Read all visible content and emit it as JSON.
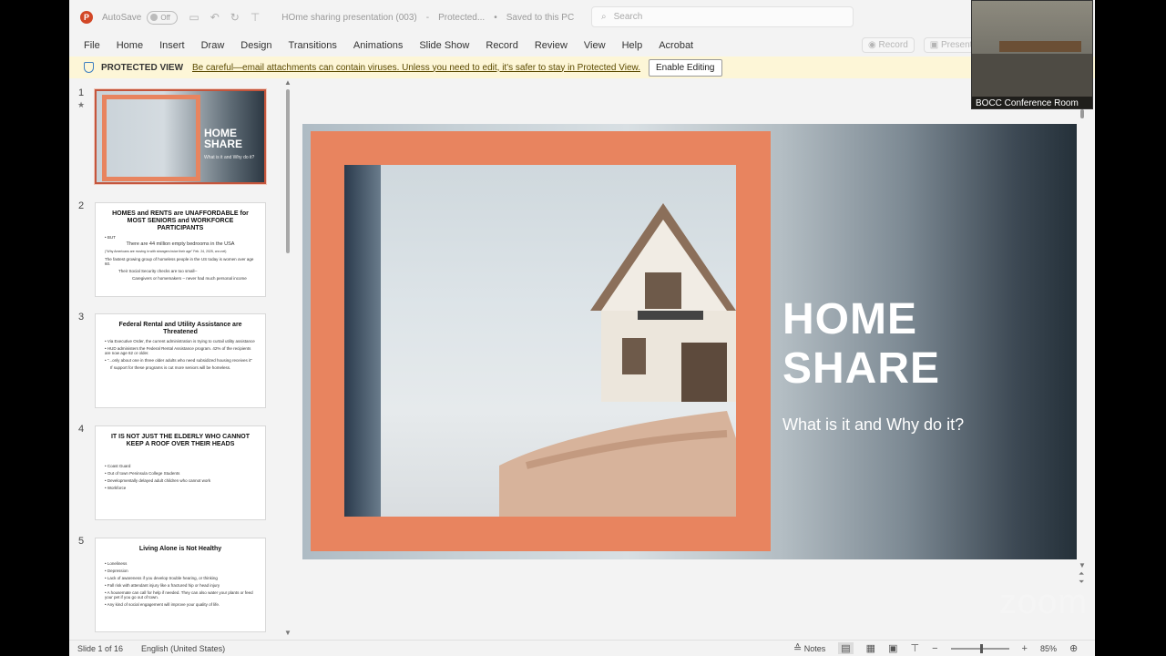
{
  "titlebar": {
    "app_icon": "P",
    "autosave_label": "AutoSave",
    "autosave_state": "Off",
    "doc_title": "HOme sharing presentation (003)",
    "protected": "Protected...",
    "saved_status": "Saved to this PC",
    "search_placeholder": "Search"
  },
  "menu": {
    "items": [
      "File",
      "Home",
      "Insert",
      "Draw",
      "Design",
      "Transitions",
      "Animations",
      "Slide Show",
      "Record",
      "Review",
      "View",
      "Help",
      "Acrobat"
    ],
    "record_button": "Record",
    "present_button": "Present"
  },
  "protected_view": {
    "label": "PROTECTED VIEW",
    "message": "Be careful—email attachments can contain viruses. Unless you need to edit, it's safer to stay in Protected View.",
    "enable_button": "Enable Editing"
  },
  "thumbnails": [
    {
      "num": "1",
      "star": "★",
      "title_line1": "HOME",
      "title_line2": "SHARE",
      "subtitle": "What is it and Why do it?"
    },
    {
      "num": "2",
      "title": "HOMES and RENTS are UNAFFORDABLE for MOST SENIORS and WORKFORCE PARTICIPANTS",
      "lines": [
        "• BUT",
        "There are 44 million empty bedrooms in the USA",
        "(\"Why Americans are moving in with strangers twice their age\" Feb. 24, 2025, cnn.net)",
        "The fastest growing group of homeless people in the US today is women over age 60.",
        "Their Social Security checks are too small--",
        "Caregivers or homemakers – never had much personal income"
      ]
    },
    {
      "num": "3",
      "title": "Federal Rental and Utility Assistance are Threatened",
      "lines": [
        "• Via Executive Order, the current administration is trying to curtail utility assistance",
        "• HUD administers the Federal Rental Assistance program. 42% of the recipients are now age 62 or older.",
        "• \"...only about one in three older adults who need subsidized housing receives it\"",
        "If support for these programs is cut more seniors will be homeless."
      ]
    },
    {
      "num": "4",
      "title": "IT IS NOT JUST THE ELDERLY WHO CANNOT KEEP A ROOF OVER THEIR HEADS",
      "lines": [
        "• Coast Guard",
        "• Out of town Peninsula College Students",
        "• Developmentally delayed adult children who cannot work",
        "• Workforce"
      ]
    },
    {
      "num": "5",
      "title": "Living Alone is Not Healthy",
      "lines": [
        "• Loneliness",
        "• Depression",
        "• Lack of awareness if you develop trouble hearing, or thinking",
        "• Fall risk with attendant injury like a fractured hip or head injury",
        "• A housemate can call for help if needed. They can also water your plants or feed your pet if you go out of town.",
        "• Any kind of social engagement will improve your quality of life."
      ]
    }
  ],
  "slide": {
    "title_line1": "HOME",
    "title_line2": "SHARE",
    "subtitle": "What is it and Why do it?"
  },
  "status": {
    "slide_info": "Slide 1 of 16",
    "language": "English (United States)",
    "notes_label": "Notes",
    "zoom": "85%"
  },
  "zoom_overlay": {
    "camera_label": "BOCC Conference Room",
    "watermark": "zoom"
  },
  "colors": {
    "accent_frame": "#e8845f",
    "selected_border": "#c4553c",
    "protected_bar": "#fdf6d7"
  }
}
